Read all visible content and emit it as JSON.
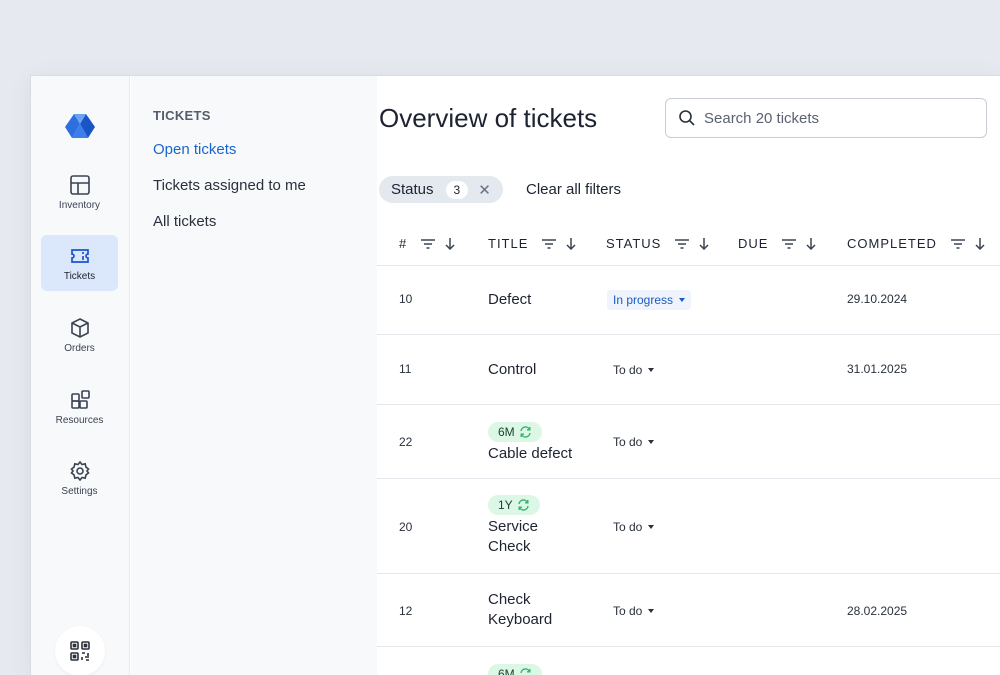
{
  "rail": {
    "items": [
      {
        "label": "Inventory",
        "icon": "grid-icon"
      },
      {
        "label": "Tickets",
        "icon": "ticket-icon",
        "active": true
      },
      {
        "label": "Orders",
        "icon": "box-icon"
      },
      {
        "label": "Resources",
        "icon": "resources-icon"
      },
      {
        "label": "Settings",
        "icon": "gear-icon"
      }
    ]
  },
  "subnav": {
    "title": "TICKETS",
    "items": [
      {
        "label": "Open tickets",
        "active": true
      },
      {
        "label": "Tickets assigned to me"
      },
      {
        "label": "All tickets"
      }
    ]
  },
  "main": {
    "title": "Overview of tickets",
    "search_placeholder": "Search 20 tickets",
    "filter_chip": {
      "label": "Status",
      "count": "3"
    },
    "clear_filters": "Clear all filters"
  },
  "table": {
    "columns": [
      "#",
      "TITLE",
      "STATUS",
      "DUE",
      "COMPLETED"
    ],
    "rows": [
      {
        "num": "10",
        "badge": "",
        "title": [
          "Defect"
        ],
        "status": "In progress",
        "due": "",
        "completed": "29.10.2024"
      },
      {
        "num": "11",
        "badge": "",
        "title": [
          "Control"
        ],
        "status": "To do",
        "due": "",
        "completed": "31.01.2025"
      },
      {
        "num": "22",
        "badge": "6M",
        "title": [
          "Cable defect"
        ],
        "status": "To do",
        "due": "",
        "completed": ""
      },
      {
        "num": "20",
        "badge": "1Y",
        "title": [
          "Service",
          "Check"
        ],
        "status": "To do",
        "due": "",
        "completed": ""
      },
      {
        "num": "12",
        "badge": "",
        "title": [
          "Check",
          "Keyboard"
        ],
        "status": "To do",
        "due": "",
        "completed": "28.02.2025"
      },
      {
        "num": "",
        "badge": "6M",
        "title": [],
        "status": "",
        "due": "",
        "completed": ""
      }
    ]
  },
  "colors": {
    "accent": "#1a66cf",
    "active_nav_bg": "#dbe8fb",
    "badge_bg": "#dcf7e6",
    "recurring_icon": "#2fb56a"
  }
}
